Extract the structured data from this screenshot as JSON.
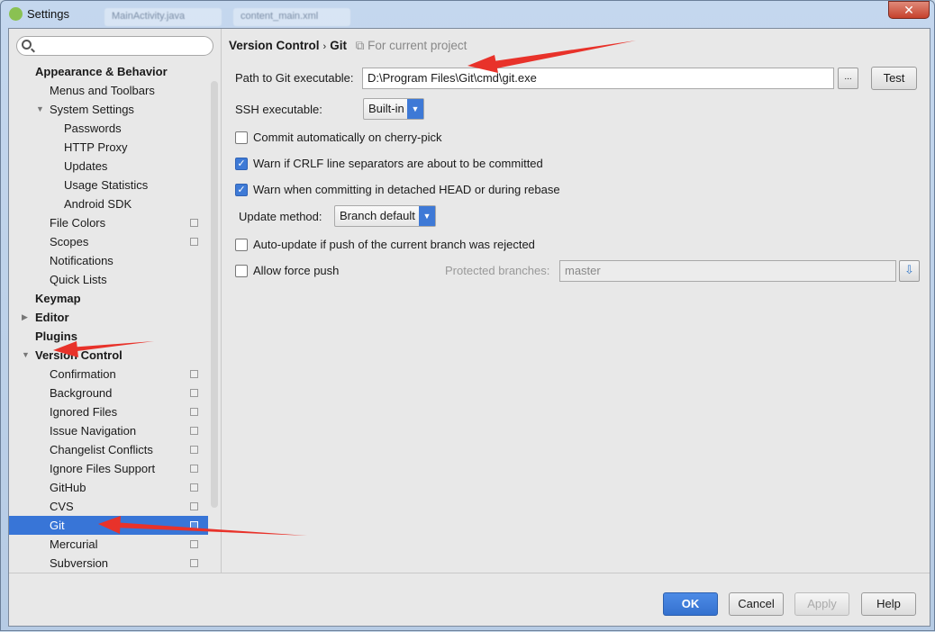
{
  "window": {
    "title": "Settings",
    "close_glyph": "✕",
    "background_tabs": [
      "MainActivity.java",
      "content_main.xml"
    ]
  },
  "sidebar": {
    "search_placeholder": "",
    "items": [
      {
        "label": "Appearance & Behavior",
        "level": 0,
        "bold": true
      },
      {
        "label": "Menus and Toolbars",
        "level": 1
      },
      {
        "label": "System Settings",
        "level": 1,
        "expanded": true
      },
      {
        "label": "Passwords",
        "level": 2
      },
      {
        "label": "HTTP Proxy",
        "level": 2
      },
      {
        "label": "Updates",
        "level": 2
      },
      {
        "label": "Usage Statistics",
        "level": 2
      },
      {
        "label": "Android SDK",
        "level": 2
      },
      {
        "label": "File Colors",
        "level": 1,
        "project": true
      },
      {
        "label": "Scopes",
        "level": 1,
        "project": true
      },
      {
        "label": "Notifications",
        "level": 1
      },
      {
        "label": "Quick Lists",
        "level": 1
      },
      {
        "label": "Keymap",
        "level": 0,
        "bold": true
      },
      {
        "label": "Editor",
        "level": 0,
        "bold": true,
        "collapsed": true
      },
      {
        "label": "Plugins",
        "level": 0,
        "bold": true
      },
      {
        "label": "Version Control",
        "level": 0,
        "bold": true,
        "expanded": true
      },
      {
        "label": "Confirmation",
        "level": 1,
        "project": true
      },
      {
        "label": "Background",
        "level": 1,
        "project": true
      },
      {
        "label": "Ignored Files",
        "level": 1,
        "project": true
      },
      {
        "label": "Issue Navigation",
        "level": 1,
        "project": true
      },
      {
        "label": "Changelist Conflicts",
        "level": 1,
        "project": true
      },
      {
        "label": "Ignore Files Support",
        "level": 1,
        "project": true
      },
      {
        "label": "GitHub",
        "level": 1,
        "project": true
      },
      {
        "label": "CVS",
        "level": 1,
        "project": true
      },
      {
        "label": "Git",
        "level": 1,
        "project": true,
        "selected": true
      },
      {
        "label": "Mercurial",
        "level": 1,
        "project": true
      },
      {
        "label": "Subversion",
        "level": 1,
        "project": true
      }
    ]
  },
  "breadcrumb": {
    "parent": "Version Control",
    "separator": "›",
    "current": "Git",
    "scope": "For current project"
  },
  "git": {
    "path_label": "Path to Git executable:",
    "path_value": "D:\\Program Files\\Git\\cmd\\git.exe",
    "browse_label": "...",
    "test_label": "Test",
    "ssh_label": "SSH executable:",
    "ssh_value": "Built-in",
    "commit_cherry_pick": {
      "label": "Commit automatically on cherry-pick",
      "checked": false
    },
    "warn_crlf": {
      "label": "Warn if CRLF line separators are about to be committed",
      "checked": true
    },
    "warn_detached": {
      "label": "Warn when committing in detached HEAD or during rebase",
      "checked": true
    },
    "update_method_label": "Update method:",
    "update_method_value": "Branch default",
    "auto_update": {
      "label": "Auto-update if push of the current branch was rejected",
      "checked": false
    },
    "allow_force_push": {
      "label": "Allow force push",
      "checked": false
    },
    "protected_label": "Protected branches:",
    "protected_value": "master"
  },
  "footer": {
    "ok": "OK",
    "cancel": "Cancel",
    "apply": "Apply",
    "help": "Help"
  },
  "colors": {
    "accent": "#3875d7",
    "annotation": "#e8322a"
  }
}
